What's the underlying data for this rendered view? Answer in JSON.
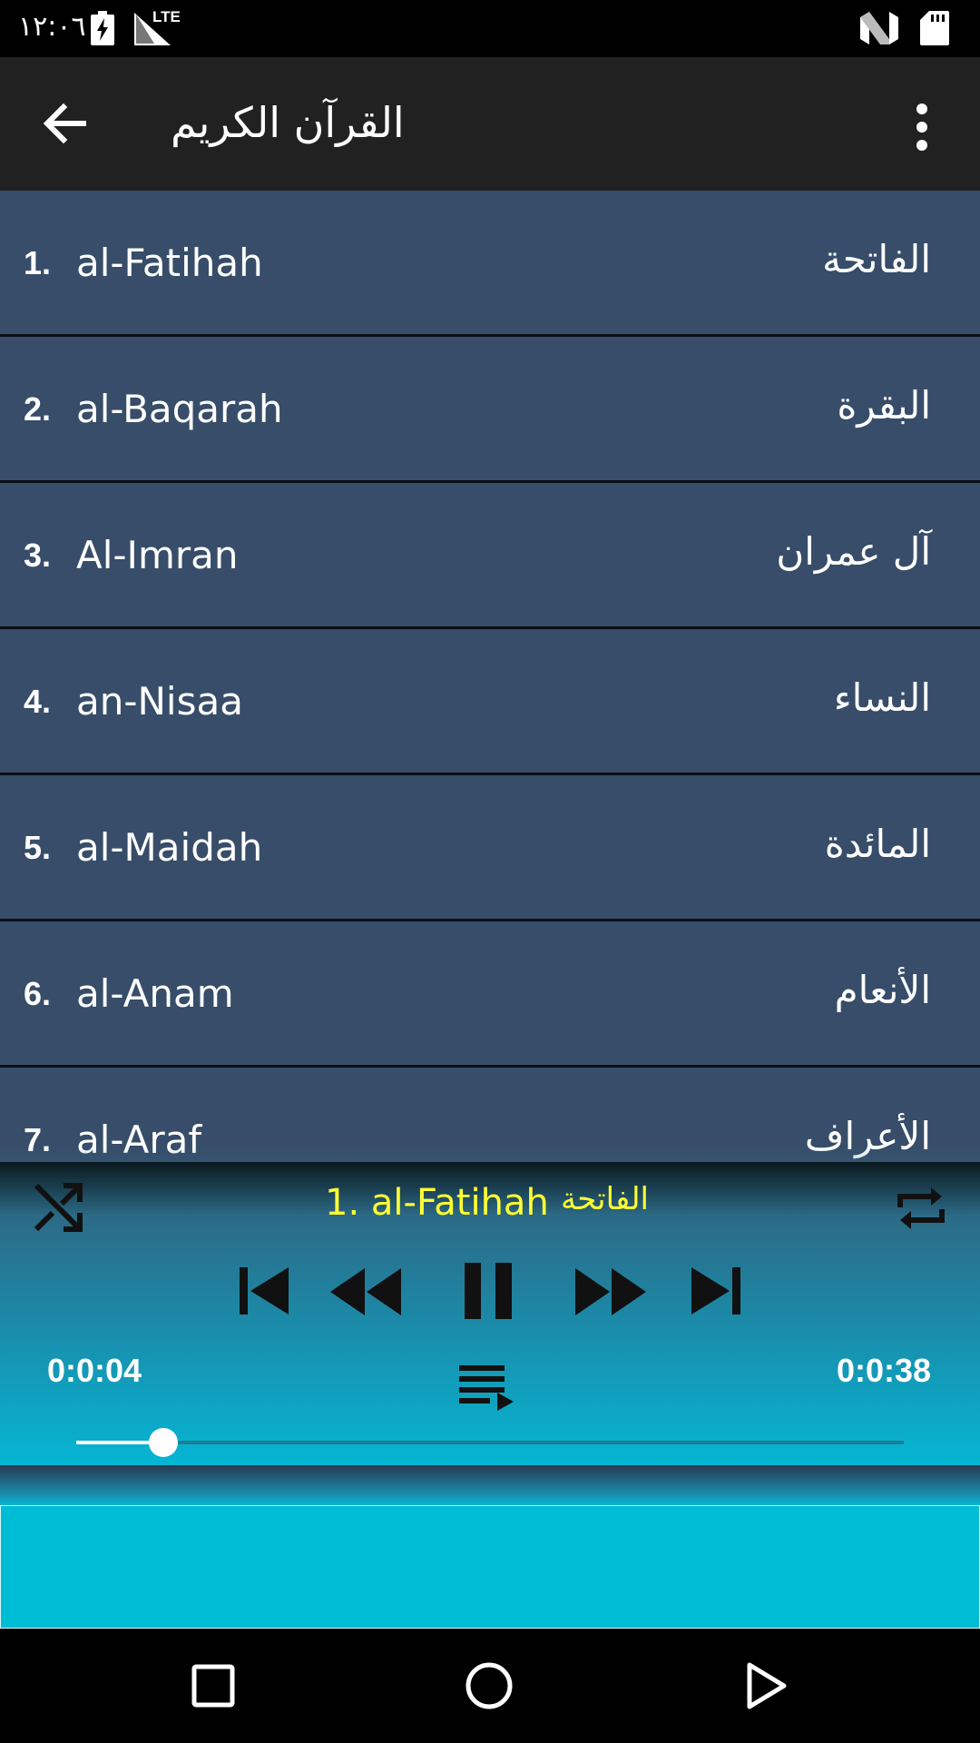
{
  "status_bar": {
    "time": "١٢:٠٦",
    "network_label": "LTE",
    "icons": [
      "battery-charging-icon",
      "signal-icon",
      "n-notification-icon",
      "sd-card-icon"
    ]
  },
  "app_bar": {
    "title": "القرآن الكريم",
    "icons": [
      "back-arrow-icon",
      "more-vert-icon"
    ]
  },
  "surahs": [
    {
      "num": "1.",
      "latin": "al-Fatihah",
      "arabic": "الفاتحة"
    },
    {
      "num": "2.",
      "latin": "al-Baqarah",
      "arabic": "البقرة"
    },
    {
      "num": "3.",
      "latin": "Al-Imran",
      "arabic": "آل عمران"
    },
    {
      "num": "4.",
      "latin": "an-Nisaa",
      "arabic": "النساء"
    },
    {
      "num": "5.",
      "latin": "al-Maidah",
      "arabic": "المائدة"
    },
    {
      "num": "6.",
      "latin": "al-Anam",
      "arabic": "الأنعام"
    },
    {
      "num": "7.",
      "latin": "al-Araf",
      "arabic": "الأعراف"
    }
  ],
  "player": {
    "now_playing": "1. al-Fatihah",
    "now_playing_arabic": "الفاتحة",
    "elapsed": "0:0:04",
    "duration": "0:0:38",
    "progress_fraction": 0.105,
    "icons": [
      "shuffle-icon",
      "repeat-icon",
      "skip-previous-icon",
      "rewind-icon",
      "pause-icon",
      "fast-forward-icon",
      "skip-next-icon",
      "playlist-icon"
    ]
  },
  "nav_bar": {
    "icons": [
      "recents-square-icon",
      "home-circle-icon",
      "back-triangle-icon"
    ]
  },
  "colors": {
    "row_bg": "#374d69",
    "app_bar": "#212121",
    "accent_text": "#ffff33",
    "player_bottom": "#05b6d4",
    "ad_bg": "#00bcd4"
  }
}
